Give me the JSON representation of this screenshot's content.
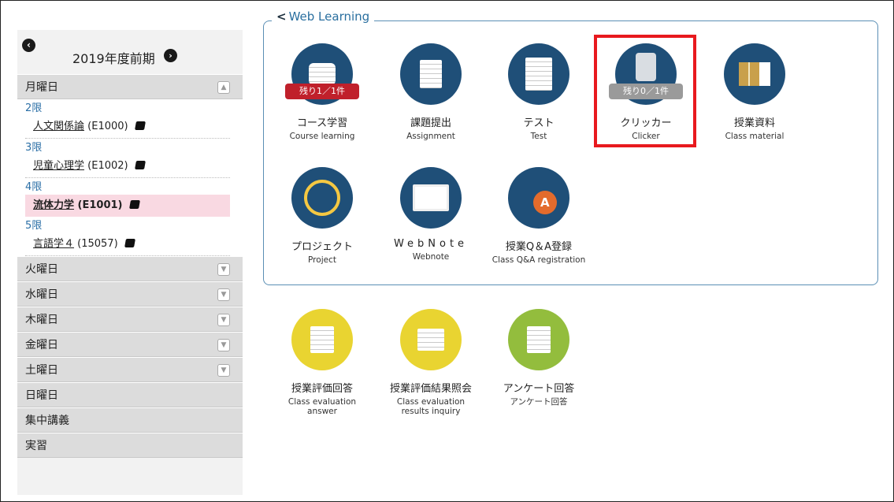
{
  "sidebar": {
    "term_label": "2019年度前期",
    "monday": {
      "label": "月曜日",
      "periods": [
        {
          "label": "2限",
          "course": "人文関係論",
          "code": "(E1000)"
        },
        {
          "label": "3限",
          "course": "児童心理学",
          "code": "(E1002)"
        },
        {
          "label": "4限",
          "course": "流体力学",
          "code": "(E1001)"
        },
        {
          "label": "5限",
          "course": "言語学４",
          "code": "(15057)"
        }
      ]
    },
    "days": [
      "火曜日",
      "水曜日",
      "木曜日",
      "金曜日",
      "土曜日",
      "日曜日",
      "集中講義",
      "実習"
    ]
  },
  "web_learning": {
    "title": "Web Learning",
    "tiles": [
      {
        "ja": "コース学習",
        "en": "Course learning",
        "badge": "残り1／1件",
        "icon": "course-learning-icon"
      },
      {
        "ja": "課題提出",
        "en": "Assignment",
        "icon": "assignment-icon"
      },
      {
        "ja": "テスト",
        "en": "Test",
        "icon": "test-icon"
      },
      {
        "ja": "クリッカー",
        "en": "Clicker",
        "badge": "残り0／1件",
        "icon": "clicker-icon"
      },
      {
        "ja": "授業資料",
        "en": "Class material",
        "icon": "class-material-icon"
      },
      {
        "ja": "プロジェクト",
        "en": "Project",
        "icon": "project-icon"
      },
      {
        "ja": "WebNote",
        "en": "Webnote",
        "icon": "webnote-icon"
      },
      {
        "ja": "授業Q＆A登録",
        "en": "Class Q&A registration",
        "icon": "qa-icon"
      }
    ]
  },
  "other_tiles": [
    {
      "ja": "授業評価回答",
      "en": "Class evaluation answer",
      "icon": "evaluation-answer-icon"
    },
    {
      "ja": "授業評価結果照会",
      "en": "Class evaluation results inquiry",
      "icon": "evaluation-results-icon"
    },
    {
      "ja": "アンケート回答",
      "en": "アンケート回答",
      "icon": "survey-icon"
    }
  ],
  "colors": {
    "accent_blue": "#1f4f78",
    "highlight_red": "#e8191e",
    "badge_red": "#c0202b",
    "badge_gray": "#9a9a9a",
    "active_course_bg": "#f9d9e2"
  }
}
